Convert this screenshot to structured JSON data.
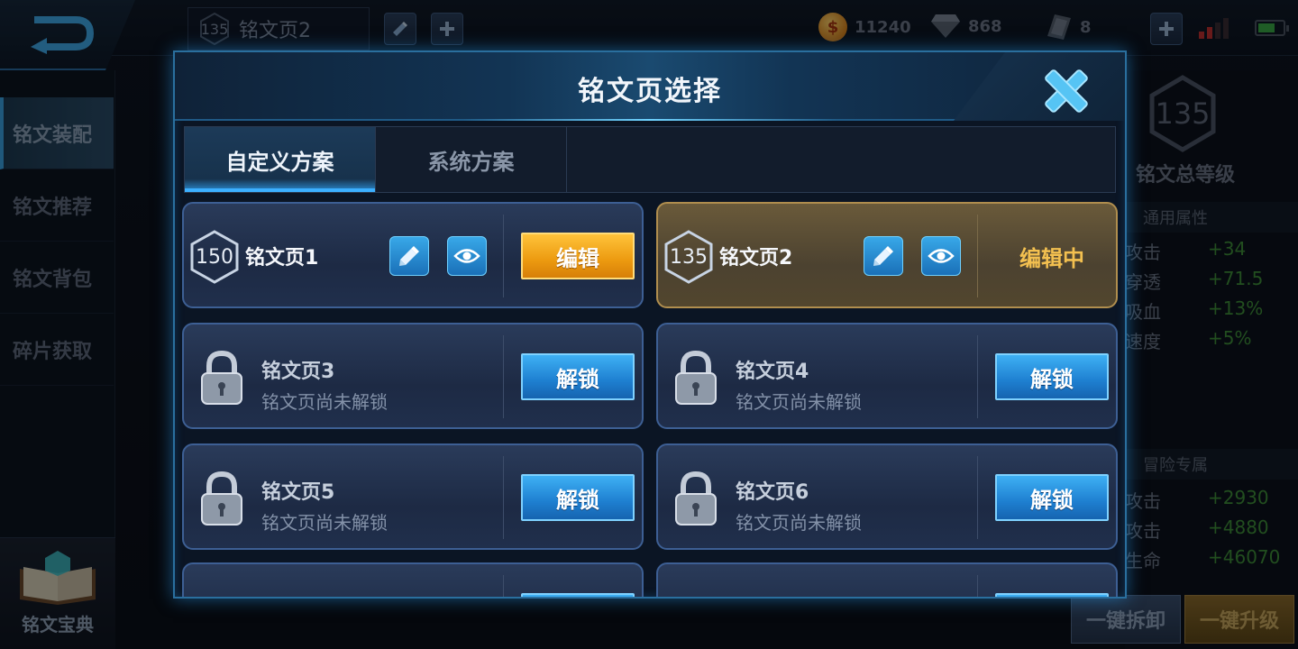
{
  "topbar": {
    "page_level": "135",
    "page_name": "铭文页2",
    "gold": "11240",
    "gems": "868",
    "fragments": "8"
  },
  "sidebar": {
    "items": [
      {
        "label": "铭文装配",
        "active": true
      },
      {
        "label": "铭文推荐",
        "active": false
      },
      {
        "label": "铭文背包",
        "active": false
      },
      {
        "label": "碎片获取",
        "active": false
      }
    ],
    "codex_label": "铭文宝典"
  },
  "right_panel": {
    "total_level": "135",
    "total_level_label": "铭文总等级",
    "general_section": "通用属性",
    "general_stats": [
      {
        "name": "攻击",
        "value": "+34"
      },
      {
        "name": "穿透",
        "value": "+71.5"
      },
      {
        "name": "吸血",
        "value": "+13%"
      },
      {
        "name": "速度",
        "value": "+5%"
      }
    ],
    "adventure_section": "冒险专属",
    "adventure_stats": [
      {
        "name": "攻击",
        "value": "+2930"
      },
      {
        "name": "攻击",
        "value": "+4880"
      },
      {
        "name": "生命",
        "value": "+46070"
      }
    ],
    "dismantle_all": "一键拆卸",
    "upgrade_all": "一键升级"
  },
  "modal": {
    "title": "铭文页选择",
    "tabs": [
      {
        "label": "自定义方案",
        "active": true
      },
      {
        "label": "系统方案",
        "active": false
      }
    ],
    "pages": [
      {
        "level": "150",
        "name": "铭文页1",
        "action": "编辑",
        "state": "unlocked"
      },
      {
        "level": "135",
        "name": "铭文页2",
        "action": "编辑中",
        "state": "current"
      },
      {
        "name": "铭文页3",
        "sub": "铭文页尚未解锁",
        "action": "解锁",
        "state": "locked"
      },
      {
        "name": "铭文页4",
        "sub": "铭文页尚未解锁",
        "action": "解锁",
        "state": "locked"
      },
      {
        "name": "铭文页5",
        "sub": "铭文页尚未解锁",
        "action": "解锁",
        "state": "locked"
      },
      {
        "name": "铭文页6",
        "sub": "铭文页尚未解锁",
        "action": "解锁",
        "state": "locked"
      }
    ]
  },
  "colors": {
    "accent_blue": "#3cb0ff",
    "gold_button": "#ec9a10",
    "stat_green": "#3e8e3a",
    "editing_text": "#f3c050"
  },
  "icons": [
    "back-arrow-icon",
    "edit-pencil-icon",
    "eye-icon",
    "lock-icon",
    "close-icon",
    "plus-icon",
    "gold-coin-icon",
    "gem-icon",
    "book-icon"
  ]
}
